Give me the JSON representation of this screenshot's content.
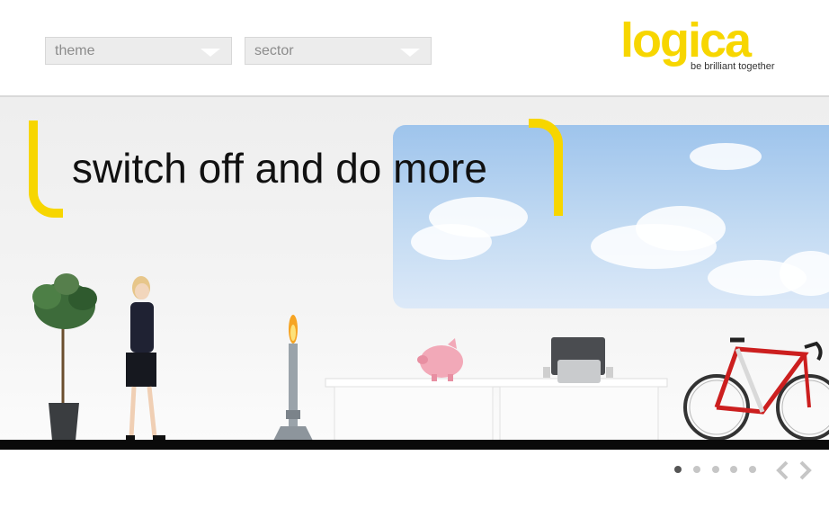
{
  "filters": {
    "theme": {
      "value": "theme",
      "icon": "chevron-down-icon"
    },
    "sector": {
      "value": "sector",
      "icon": "chevron-down-icon"
    }
  },
  "logo": {
    "name": "logica",
    "tagline": "be brilliant together",
    "color": "#f7d600"
  },
  "hero": {
    "headline": "switch off and do more",
    "accent_color": "#f7d600"
  },
  "scene_items": [
    "plant-icon",
    "businesswoman-image",
    "bunsen-burner-icon",
    "piggy-bank-icon",
    "laptop-icon",
    "bicycle-icon"
  ],
  "carousel": {
    "slide_count": 5,
    "active_index": 0,
    "prev_icon": "chevron-left-icon",
    "next_icon": "chevron-right-icon"
  }
}
